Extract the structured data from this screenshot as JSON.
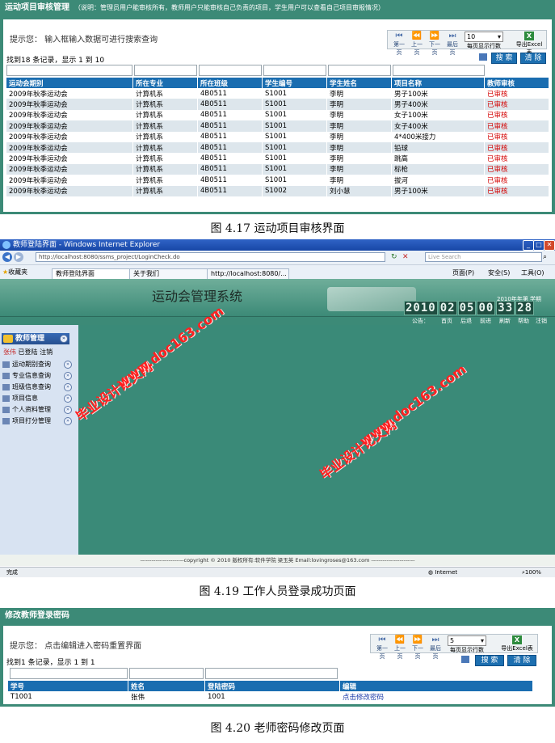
{
  "panel1": {
    "title": "运动项目审核管理",
    "note": "（说明：管理员用户能审核所有，教师用户只能审核自己负责的项目，学生用户可以查看自己项目审报情况）",
    "hint": "提示您：   输入框输入数据可进行搜索查询",
    "nav": [
      "第一页",
      "上一页",
      "下一页",
      "最后页"
    ],
    "rows_per_page_value": "10",
    "rows_per_page_label": "每页显示行数",
    "excel_label": "导出Excel表",
    "count_text": "找到18 条记录，显示 1 到 10",
    "search_btn": "搜 索",
    "clear_btn": "清 除",
    "columns": [
      "运动会期别",
      "所在专业",
      "所在班级",
      "学生编号",
      "学生姓名",
      "项目名称",
      "教师审核"
    ],
    "rows": [
      [
        "2009年秋季运动会",
        "计算机系",
        "4B0511",
        "S1001",
        "李明",
        "男子100米",
        "已审核"
      ],
      [
        "2009年秋季运动会",
        "计算机系",
        "4B0511",
        "S1001",
        "李明",
        "男子400米",
        "已审核"
      ],
      [
        "2009年秋季运动会",
        "计算机系",
        "4B0511",
        "S1001",
        "李明",
        "女子100米",
        "已审核"
      ],
      [
        "2009年秋季运动会",
        "计算机系",
        "4B0511",
        "S1001",
        "李明",
        "女子400米",
        "已审核"
      ],
      [
        "2009年秋季运动会",
        "计算机系",
        "4B0511",
        "S1001",
        "李明",
        "4*400米接力",
        "已审核"
      ],
      [
        "2009年秋季运动会",
        "计算机系",
        "4B0511",
        "S1001",
        "李明",
        "铅球",
        "已审核"
      ],
      [
        "2009年秋季运动会",
        "计算机系",
        "4B0511",
        "S1001",
        "李明",
        "跳高",
        "已审核"
      ],
      [
        "2009年秋季运动会",
        "计算机系",
        "4B0511",
        "S1001",
        "李明",
        "标枪",
        "已审核"
      ],
      [
        "2009年秋季运动会",
        "计算机系",
        "4B0511",
        "S1001",
        "李明",
        "拔河",
        "已审核"
      ],
      [
        "2009年秋季运动会",
        "计算机系",
        "4B0511",
        "S1002",
        "刘小慧",
        "男子100米",
        "已审核"
      ]
    ]
  },
  "caption1": "图 4.17  运动项目审核界面",
  "browser": {
    "title": "教师登陆界面 - Windows Internet Explorer",
    "address": "http://localhost:8080/ssms_project/LoginCheck.do",
    "search_placeholder": "Live Search",
    "favorites": "收藏夹",
    "tabs": [
      "教师登陆界面",
      "关于我们",
      "http://localhost:8080/..."
    ],
    "toolbar_right": [
      "页面(P)",
      "安全(S)",
      "工具(O)"
    ],
    "status_left": "完成",
    "status_zone": "Internet",
    "zoom": "100%"
  },
  "app": {
    "system_title": "运动会管理系统",
    "term": "2010年年第   学期",
    "clock": [
      "2010",
      "02",
      "05",
      "00",
      "33",
      "28"
    ],
    "notice_label": "公告：",
    "top_links": [
      "首页",
      "后退",
      "前进",
      "刷新",
      "帮助",
      "注销"
    ],
    "menu_title": "教师管理",
    "user": "张伟",
    "login_state": "已登陆",
    "logout": "注销",
    "menu_items": [
      "运动期别查询",
      "专业信息查询",
      "班级信息查询",
      "项目信息",
      "个人资料管理",
      "项目打分管理"
    ],
    "footer": "-----------------------copyright © 2010 版权所有:软件学院 梁玉英  Email:lovingroses@163.com -----------------------",
    "watermark1": "毕业设计论文网",
    "watermark2": "www.doc163.com"
  },
  "caption2": "图 4.19  工作人员登录成功页面",
  "panel3": {
    "title": "修改教师登录密码",
    "hint": "提示您：  点击编辑进入密码重置界面",
    "nav": [
      "第一页",
      "上一页",
      "下一页",
      "最后页"
    ],
    "rows_per_page_value": "5",
    "rows_per_page_label": "每页显示行数",
    "excel_label": "导出Excel表",
    "count_text": "找到1 条记录，显示 1 到 1",
    "search_btn": "搜 索",
    "clear_btn": "清 除",
    "columns": [
      "学号",
      "姓名",
      "登陆密码",
      "编辑"
    ],
    "rows": [
      [
        "T1001",
        "张伟",
        "1001",
        "点击修改密码"
      ]
    ]
  },
  "caption3": "图 4.20  老师密码修改页面",
  "colors": {
    "panel_green": "#3c8a77",
    "table_header": "#1a6db0",
    "audited_red": "#d40000",
    "watermark_red": "#ff2020"
  }
}
